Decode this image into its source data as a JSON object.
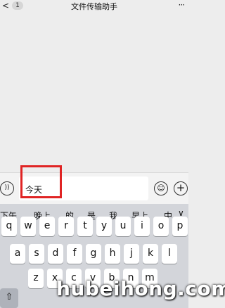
{
  "header": {
    "back_icon": "chevron-left-icon",
    "back_glyph": "<",
    "unread_count": "1",
    "title": "文件传输助手",
    "more_glyph": "···"
  },
  "input_bar": {
    "text": "今天",
    "voice_glyph": "))",
    "emoji_glyph": "☺",
    "plus_glyph": "+"
  },
  "keyboard": {
    "candidates": [
      "下午",
      "晚上",
      "的",
      "是",
      "我",
      "早上",
      "中"
    ],
    "collapse_glyph": "∨",
    "row1": [
      "q",
      "w",
      "e",
      "r",
      "t",
      "y",
      "u",
      "i",
      "o",
      "p"
    ],
    "row2": [
      "a",
      "s",
      "d",
      "f",
      "g",
      "h",
      "j",
      "k",
      "l"
    ],
    "row3": [
      "z",
      "x",
      "c",
      "v",
      "b",
      "n",
      "m"
    ],
    "shift_glyph": "⇧"
  },
  "watermark": "hubeihong.com",
  "highlight_color": "#e02424"
}
